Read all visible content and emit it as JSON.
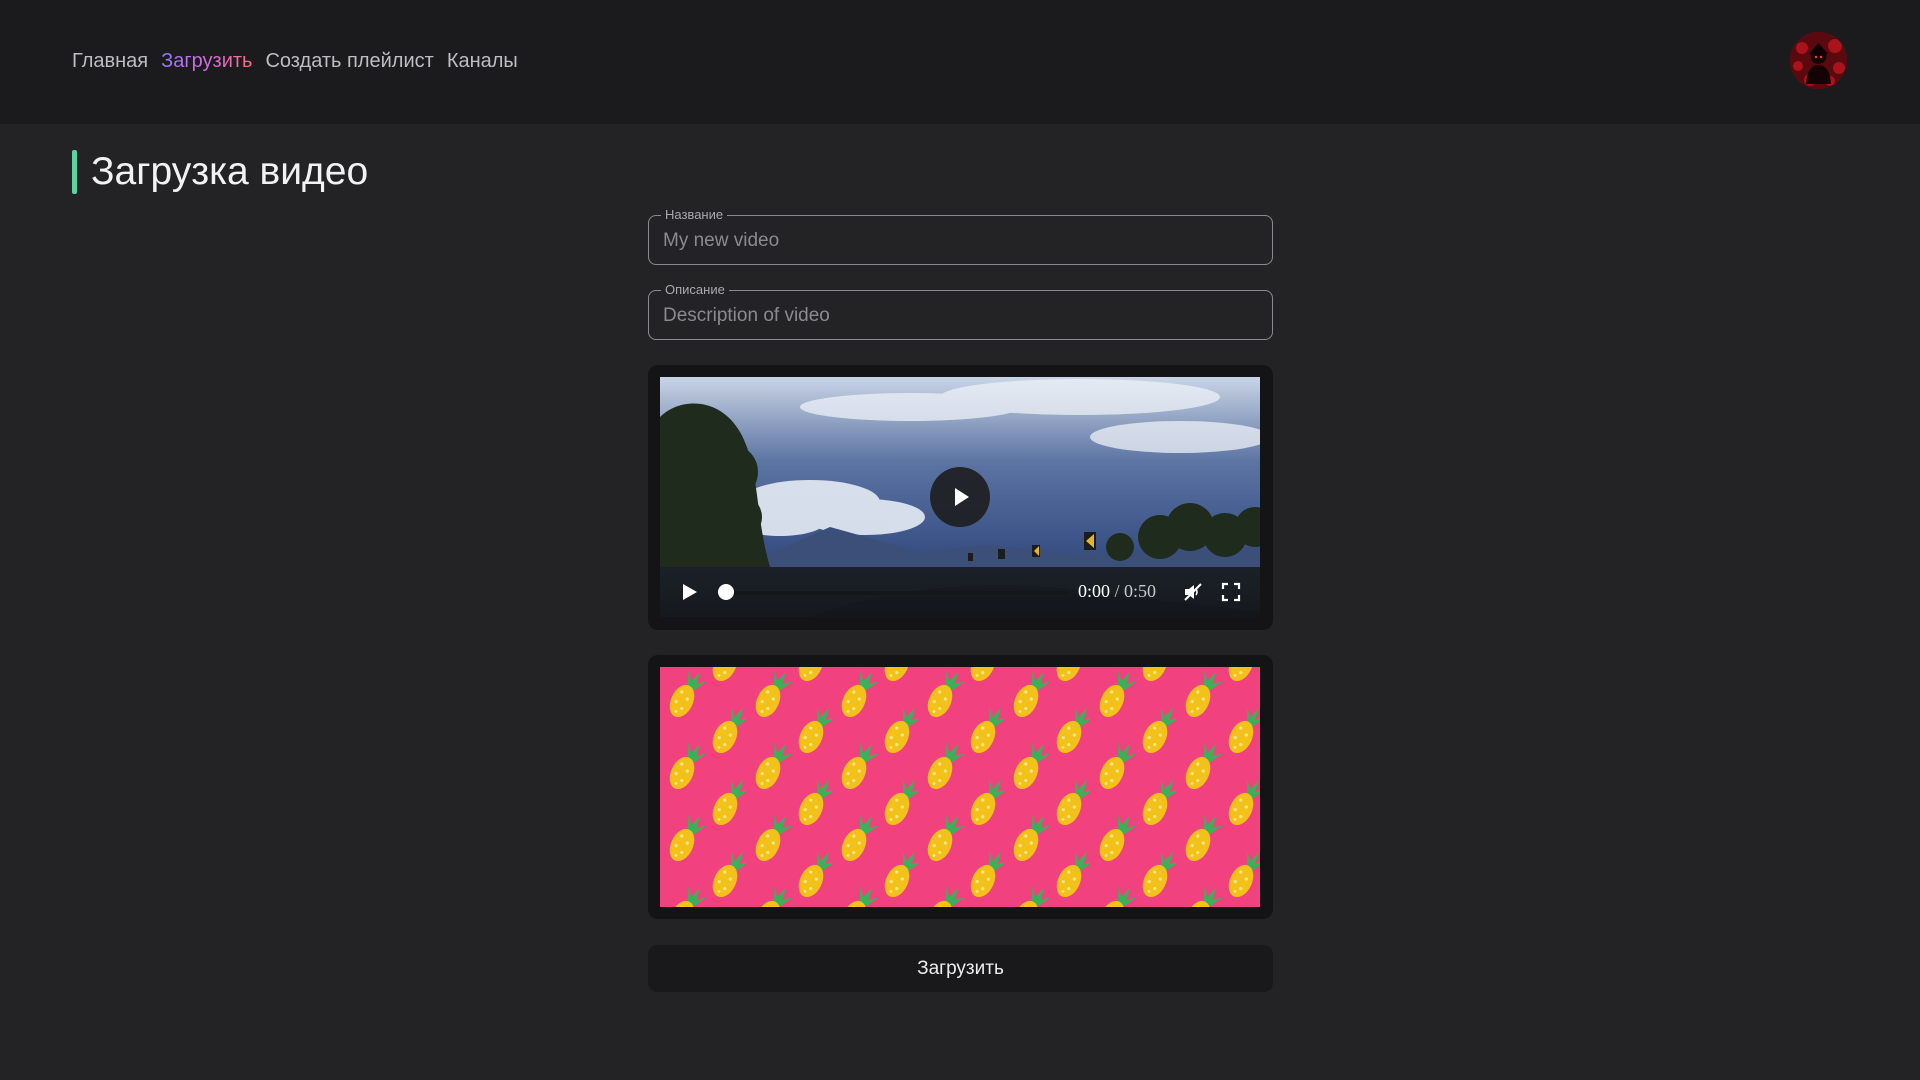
{
  "nav": {
    "items": [
      {
        "label": "Главная",
        "active": false
      },
      {
        "label": "Загрузить",
        "active": true
      },
      {
        "label": "Создать плейлист",
        "active": false
      },
      {
        "label": "Каналы",
        "active": false
      }
    ]
  },
  "page": {
    "title": "Загрузка видео"
  },
  "form": {
    "name_label": "Название",
    "name_placeholder": "My new video",
    "description_label": "Описание",
    "description_placeholder": "Description of video",
    "submit_label": "Загрузить"
  },
  "video": {
    "current_time": "0:00",
    "separator": " / ",
    "duration": "0:50",
    "progress": 0,
    "muted": true
  },
  "colors": {
    "accent_bar": "#5fd1a0",
    "header_bg": "#1b1b1d",
    "page_bg": "#232325",
    "thumbnail_bg": "#f2417f"
  },
  "icons": {
    "avatar": "avatar-image",
    "play": "play-icon",
    "mute": "volume-muted-icon",
    "fullscreen": "fullscreen-icon"
  }
}
